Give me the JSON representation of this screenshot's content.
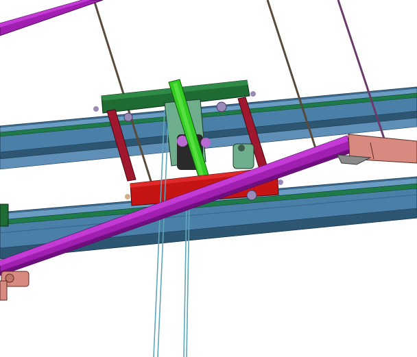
{
  "scene": {
    "subject": "cad-overhead-crane-hoist-trolley",
    "colors": {
      "background": "#ffffff",
      "beam_main": "#4a7fa8",
      "beam_light": "#6a9cc4",
      "beam_dark": "#2d5673",
      "rail_green": "#1f7a4a",
      "purple_beam": "#a01fb0",
      "purple_light": "#c43ad4",
      "purple_dark": "#6e0f7d",
      "top_plate": "#1e6b34",
      "side_post": "#a0182e",
      "hoist_body": "#c41414",
      "lever": "#33cc22",
      "motor_green": "#6fae8c",
      "salmon": "#d88a80",
      "cable": "#5a4a3a",
      "rope": "#5ea6b8",
      "bolt": "#9a8ab8"
    }
  }
}
